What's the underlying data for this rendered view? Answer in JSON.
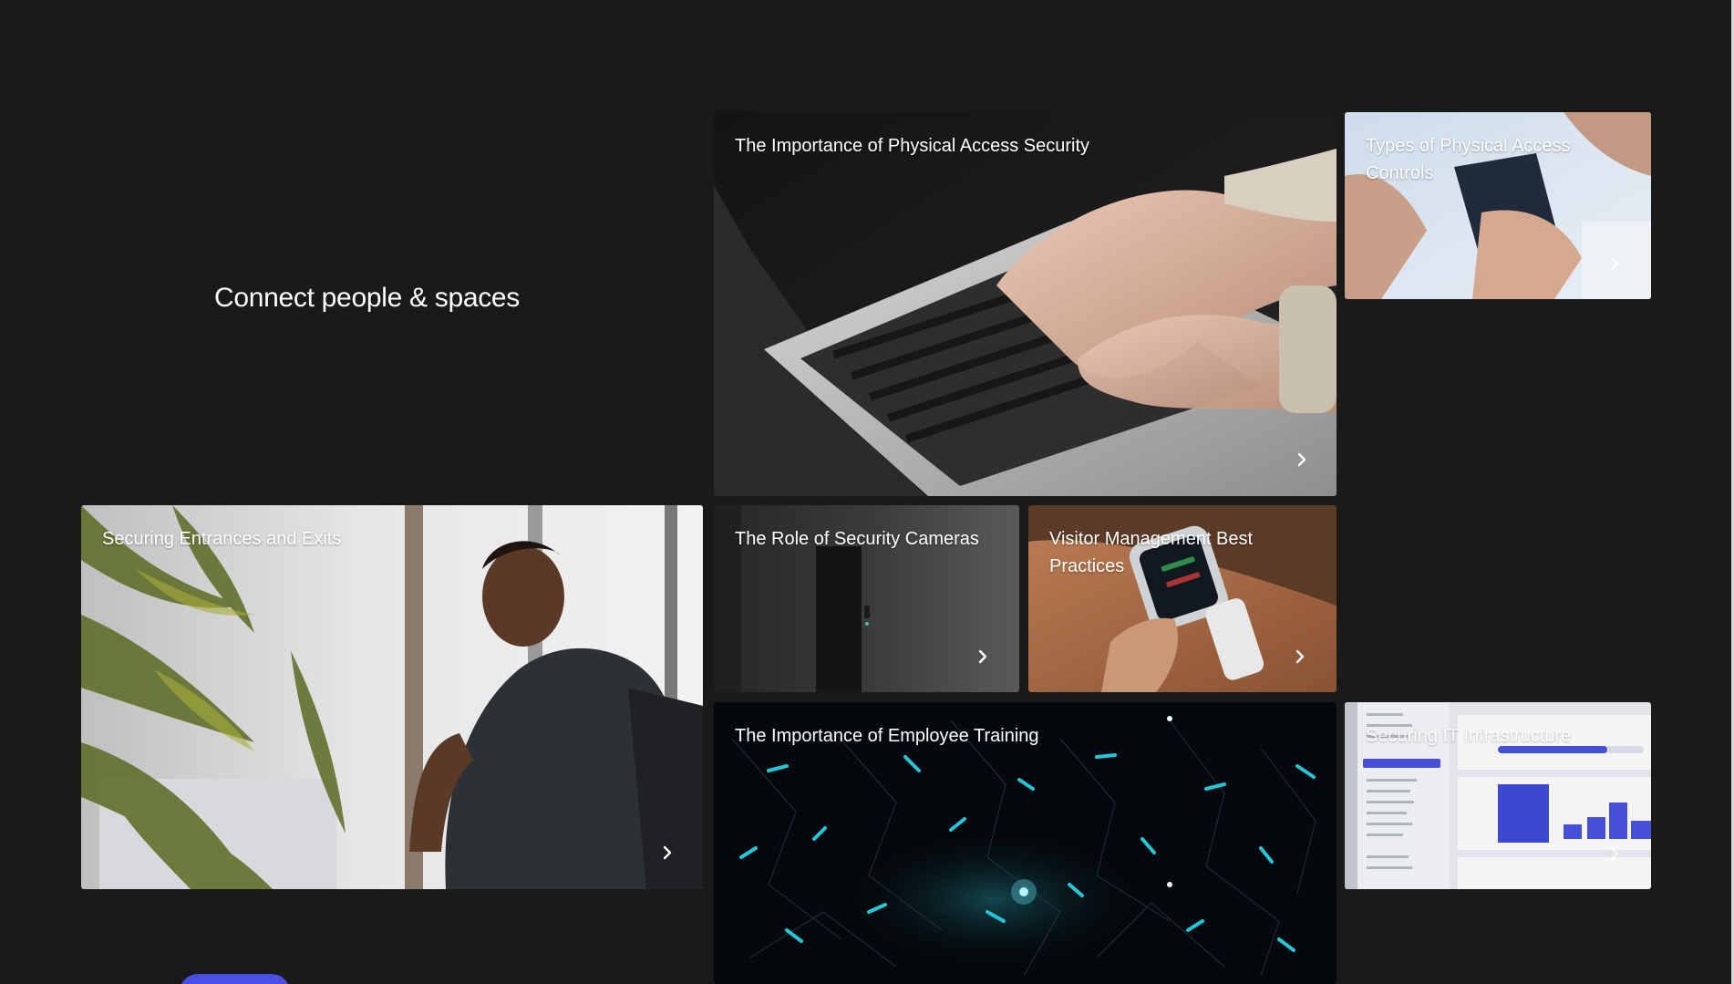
{
  "hero": {
    "title": "Connect people & spaces"
  },
  "cards": {
    "physical_access_security": {
      "title": "The Importance of Physical Access Security",
      "icon": "chevron-right-icon"
    },
    "types_access_controls": {
      "title": "Types of Physical Access Controls",
      "icon": "chevron-right-icon"
    },
    "securing_entrances": {
      "title": "Securing Entrances and Exits",
      "icon": "chevron-right-icon"
    },
    "security_cameras": {
      "title": "The Role of Security Cameras",
      "icon": "chevron-right-icon"
    },
    "visitor_management": {
      "title": "Visitor Management Best Practices",
      "icon": "chevron-right-icon"
    },
    "employee_training": {
      "title": "The Importance of Employee Training",
      "icon": "chevron-right-icon"
    },
    "securing_it": {
      "title": "Securing IT Infrastructure",
      "icon": "chevron-right-icon"
    }
  },
  "colors": {
    "page_background": "#1a1a1b",
    "accent": "#4a4de6",
    "card_text": "#ffffff"
  }
}
